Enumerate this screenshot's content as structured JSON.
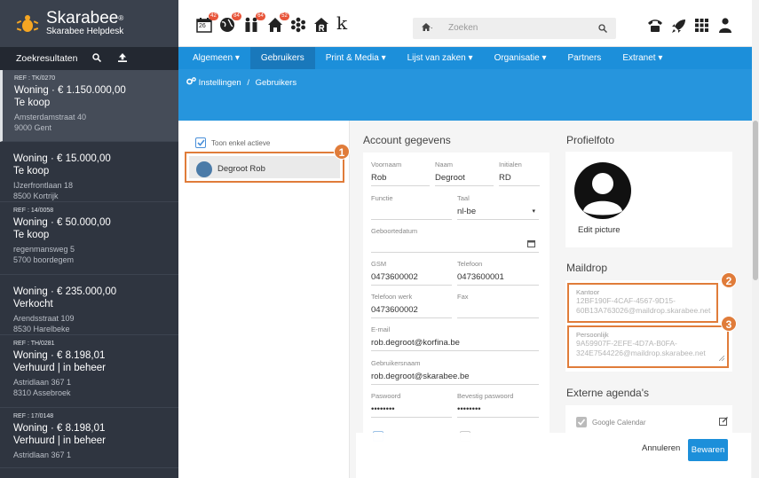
{
  "brand": {
    "title": "Skarabee",
    "reg": "®",
    "subtitle": "Skarabee Helpdesk"
  },
  "sidebar": {
    "header": "Zoekresultaten",
    "results": [
      {
        "ref": "REF : TK/0270",
        "type_price": "Woning  · € 1.150.000,00",
        "status": "Te koop",
        "street": "Amsterdamstraat 40",
        "city": "9000 Gent"
      },
      {
        "ref": "",
        "type_price": "Woning  · € 15.000,00",
        "status": "Te koop",
        "street": "IJzerfrontlaan 18",
        "city": "8500 Kortrijk"
      },
      {
        "ref": "REF : 14/0058",
        "type_price": "Woning  · € 50.000,00",
        "status": "Te koop",
        "street": "regenmansweg 5",
        "city": "5700 boordegem"
      },
      {
        "ref": "",
        "type_price": "Woning  · € 235.000,00",
        "status": "Verkocht",
        "street": "Arendsstraat 109",
        "city": "8530 Harelbeke"
      },
      {
        "ref": "REF : TH/0281",
        "type_price": "Woning  · € 8.198,01",
        "status": "Verhuurd | in beheer",
        "street": "Astridlaan 367 1",
        "city": "8310 Assebroek"
      },
      {
        "ref": "REF : 17/0148",
        "type_price": "Woning  · € 8.198,01",
        "status": "Verhuurd | in beheer",
        "street": "Astridlaan 367 1",
        "city": ""
      }
    ]
  },
  "topbar": {
    "calendar_day": "26",
    "badges": [
      "42",
      "84",
      "64",
      "52"
    ],
    "logo_k": "k",
    "search_placeholder": "Zoeken"
  },
  "nav": {
    "items": [
      {
        "label": "Algemeen",
        "caret": "▾"
      },
      {
        "label": "Gebruikers",
        "caret": ""
      },
      {
        "label": "Print & Media",
        "caret": "▾"
      },
      {
        "label": "Lijst van zaken",
        "caret": "▾"
      },
      {
        "label": "Organisatie",
        "caret": "▾"
      },
      {
        "label": "Partners",
        "caret": ""
      },
      {
        "label": "Extranet",
        "caret": "▾"
      }
    ]
  },
  "breadcrumb": {
    "root": "Instellingen",
    "sep": "/",
    "current": "Gebruikers"
  },
  "userlist": {
    "toggle_label": "Toon enkel actieve",
    "selected_user": "Degroot Rob",
    "callout": "1"
  },
  "account": {
    "title": "Account gegevens",
    "fields": {
      "voornaam": {
        "label": "Voornaam",
        "value": "Rob"
      },
      "naam": {
        "label": "Naam",
        "value": "Degroot"
      },
      "initialen": {
        "label": "Initialen",
        "value": "RD"
      },
      "functie": {
        "label": "Functie",
        "value": ""
      },
      "taal": {
        "label": "Taal",
        "value": "nl-be"
      },
      "geboortedatum": {
        "label": "Geboortedatum",
        "value": ""
      },
      "gsm": {
        "label": "GSM",
        "value": "0473600002"
      },
      "telefoon": {
        "label": "Telefoon",
        "value": "0473600001"
      },
      "telefoon_werk": {
        "label": "Telefoon werk",
        "value": "0473600002"
      },
      "fax": {
        "label": "Fax",
        "value": ""
      },
      "email": {
        "label": "E-mail",
        "value": "rob.degroot@korfina.be"
      },
      "gebruikersnaam": {
        "label": "Gebruikersnaam",
        "value": "rob.degroot@skarabee.be"
      },
      "paswoord": {
        "label": "Paswoord",
        "value": "••••••••"
      },
      "bevestig": {
        "label": "Bevestig paswoord",
        "value": "••••••••"
      }
    }
  },
  "profile": {
    "title": "Profielfoto",
    "edit": "Edit picture"
  },
  "maildrop": {
    "title": "Maildrop",
    "kantoor_label": "Kantoor",
    "kantoor_value": "12BF190F-4CAF-4567-9D15-60B13A763026@maildrop.skarabee.net",
    "persoonlijk_label": "Persoonlijk",
    "persoonlijk_value": "9A59907F-2EFE-4D7A-B0FA-324E7544226@maildrop.skarabee.net",
    "callout_kantoor": "2",
    "callout_persoonlijk": "3"
  },
  "agendas": {
    "title": "Externe agenda's",
    "google": "Google Calendar"
  },
  "footer": {
    "cancel": "Annuleren",
    "save": "Bewaren"
  },
  "colors": {
    "accent": "#1c8fda",
    "callout": "#e07c3a",
    "sidebar": "#2f3540"
  }
}
